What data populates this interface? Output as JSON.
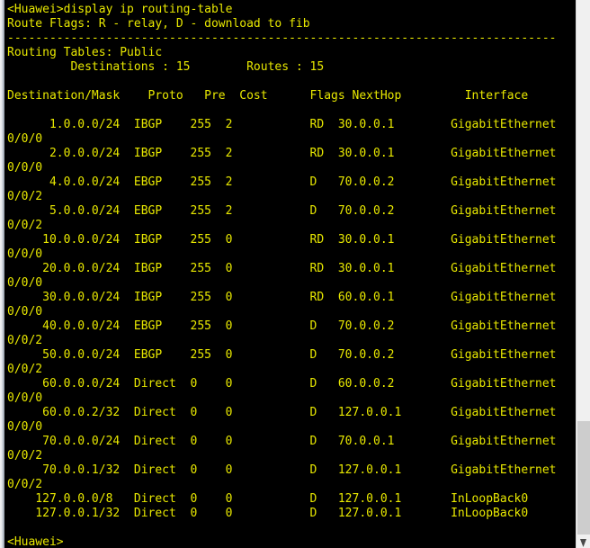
{
  "window": {
    "title": "Huawei CLI Console",
    "text_color": "#e8e800",
    "background_color": "#000000",
    "scrollbar_track_color": "#f0f0f0",
    "scrollbar_thumb_color": "#cdcdcd"
  },
  "terminal": {
    "prompt": "<Huawei>",
    "command": "display ip routing-table",
    "command_line": "<Huawei>display ip routing-table",
    "route_flags_line": "Route Flags: R - relay, D - download to fib",
    "separator": "------------------------------------------------------------------------------",
    "routing_table_label": "Routing Tables: Public",
    "summary": {
      "destinations_label": "Destinations",
      "destinations_value": "15",
      "routes_label": "Routes",
      "routes_value": "15",
      "summary_line": "         Destinations : 15        Routes : 15"
    },
    "columns": {
      "destination_mask": "Destination/Mask",
      "proto": "Proto",
      "pre": "Pre",
      "cost": "Cost",
      "flags": "Flags",
      "nexthop": "NextHop",
      "interface": "Interface",
      "header_line": "Destination/Mask    Proto   Pre  Cost      Flags NextHop         Interface"
    },
    "routes": [
      {
        "destination": "1.0.0.0/24",
        "proto": "IBGP",
        "pre": "255",
        "cost": "2",
        "flags": "RD",
        "nexthop": "30.0.0.1",
        "interface": "GigabitEthernet0/0/0"
      },
      {
        "destination": "2.0.0.0/24",
        "proto": "IBGP",
        "pre": "255",
        "cost": "2",
        "flags": "RD",
        "nexthop": "30.0.0.1",
        "interface": "GigabitEthernet0/0/0"
      },
      {
        "destination": "4.0.0.0/24",
        "proto": "EBGP",
        "pre": "255",
        "cost": "2",
        "flags": "D",
        "nexthop": "70.0.0.2",
        "interface": "GigabitEthernet0/0/2"
      },
      {
        "destination": "5.0.0.0/24",
        "proto": "EBGP",
        "pre": "255",
        "cost": "2",
        "flags": "D",
        "nexthop": "70.0.0.2",
        "interface": "GigabitEthernet0/0/2"
      },
      {
        "destination": "10.0.0.0/24",
        "proto": "IBGP",
        "pre": "255",
        "cost": "0",
        "flags": "RD",
        "nexthop": "30.0.0.1",
        "interface": "GigabitEthernet0/0/0"
      },
      {
        "destination": "20.0.0.0/24",
        "proto": "IBGP",
        "pre": "255",
        "cost": "0",
        "flags": "RD",
        "nexthop": "30.0.0.1",
        "interface": "GigabitEthernet0/0/0"
      },
      {
        "destination": "30.0.0.0/24",
        "proto": "IBGP",
        "pre": "255",
        "cost": "0",
        "flags": "RD",
        "nexthop": "60.0.0.1",
        "interface": "GigabitEthernet0/0/0"
      },
      {
        "destination": "40.0.0.0/24",
        "proto": "EBGP",
        "pre": "255",
        "cost": "0",
        "flags": "D",
        "nexthop": "70.0.0.2",
        "interface": "GigabitEthernet0/0/2"
      },
      {
        "destination": "50.0.0.0/24",
        "proto": "EBGP",
        "pre": "255",
        "cost": "0",
        "flags": "D",
        "nexthop": "70.0.0.2",
        "interface": "GigabitEthernet0/0/2"
      },
      {
        "destination": "60.0.0.0/24",
        "proto": "Direct",
        "pre": "0",
        "cost": "0",
        "flags": "D",
        "nexthop": "60.0.0.2",
        "interface": "GigabitEthernet0/0/0"
      },
      {
        "destination": "60.0.0.2/32",
        "proto": "Direct",
        "pre": "0",
        "cost": "0",
        "flags": "D",
        "nexthop": "127.0.0.1",
        "interface": "GigabitEthernet0/0/0"
      },
      {
        "destination": "70.0.0.0/24",
        "proto": "Direct",
        "pre": "0",
        "cost": "0",
        "flags": "D",
        "nexthop": "70.0.0.1",
        "interface": "GigabitEthernet0/0/2"
      },
      {
        "destination": "70.0.0.1/32",
        "proto": "Direct",
        "pre": "0",
        "cost": "0",
        "flags": "D",
        "nexthop": "127.0.0.1",
        "interface": "GigabitEthernet0/0/2"
      },
      {
        "destination": "127.0.0.0/8",
        "proto": "Direct",
        "pre": "0",
        "cost": "0",
        "flags": "D",
        "nexthop": "127.0.0.1",
        "interface": "InLoopBack0"
      },
      {
        "destination": "127.0.0.1/32",
        "proto": "Direct",
        "pre": "0",
        "cost": "0",
        "flags": "D",
        "nexthop": "127.0.0.1",
        "interface": "InLoopBack0"
      }
    ],
    "trailing_prompt": "<Huawei>",
    "screen_text": "<Huawei>display ip routing-table\nRoute Flags: R - relay, D - download to fib\n------------------------------------------------------------------------------\nRouting Tables: Public\n         Destinations : 15        Routes : 15\n\nDestination/Mask    Proto   Pre  Cost      Flags NextHop         Interface\n\n      1.0.0.0/24  IBGP    255  2           RD  30.0.0.1        GigabitEthernet\n0/0/0\n      2.0.0.0/24  IBGP    255  2           RD  30.0.0.1        GigabitEthernet\n0/0/0\n      4.0.0.0/24  EBGP    255  2           D   70.0.0.2        GigabitEthernet\n0/0/2\n      5.0.0.0/24  EBGP    255  2           D   70.0.0.2        GigabitEthernet\n0/0/2\n     10.0.0.0/24  IBGP    255  0           RD  30.0.0.1        GigabitEthernet\n0/0/0\n     20.0.0.0/24  IBGP    255  0           RD  30.0.0.1        GigabitEthernet\n0/0/0\n     30.0.0.0/24  IBGP    255  0           RD  60.0.0.1        GigabitEthernet\n0/0/0\n     40.0.0.0/24  EBGP    255  0           D   70.0.0.2        GigabitEthernet\n0/0/2\n     50.0.0.0/24  EBGP    255  0           D   70.0.0.2        GigabitEthernet\n0/0/2\n     60.0.0.0/24  Direct  0    0           D   60.0.0.2        GigabitEthernet\n0/0/0\n     60.0.0.2/32  Direct  0    0           D   127.0.0.1       GigabitEthernet\n0/0/0\n     70.0.0.0/24  Direct  0    0           D   70.0.0.1        GigabitEthernet\n0/0/2\n     70.0.0.1/32  Direct  0    0           D   127.0.0.1       GigabitEthernet\n0/0/2\n    127.0.0.0/8   Direct  0    0           D   127.0.0.1       InLoopBack0 \n    127.0.0.1/32  Direct  0    0           D   127.0.0.1       InLoopBack0 \n\n<Huawei>"
  }
}
